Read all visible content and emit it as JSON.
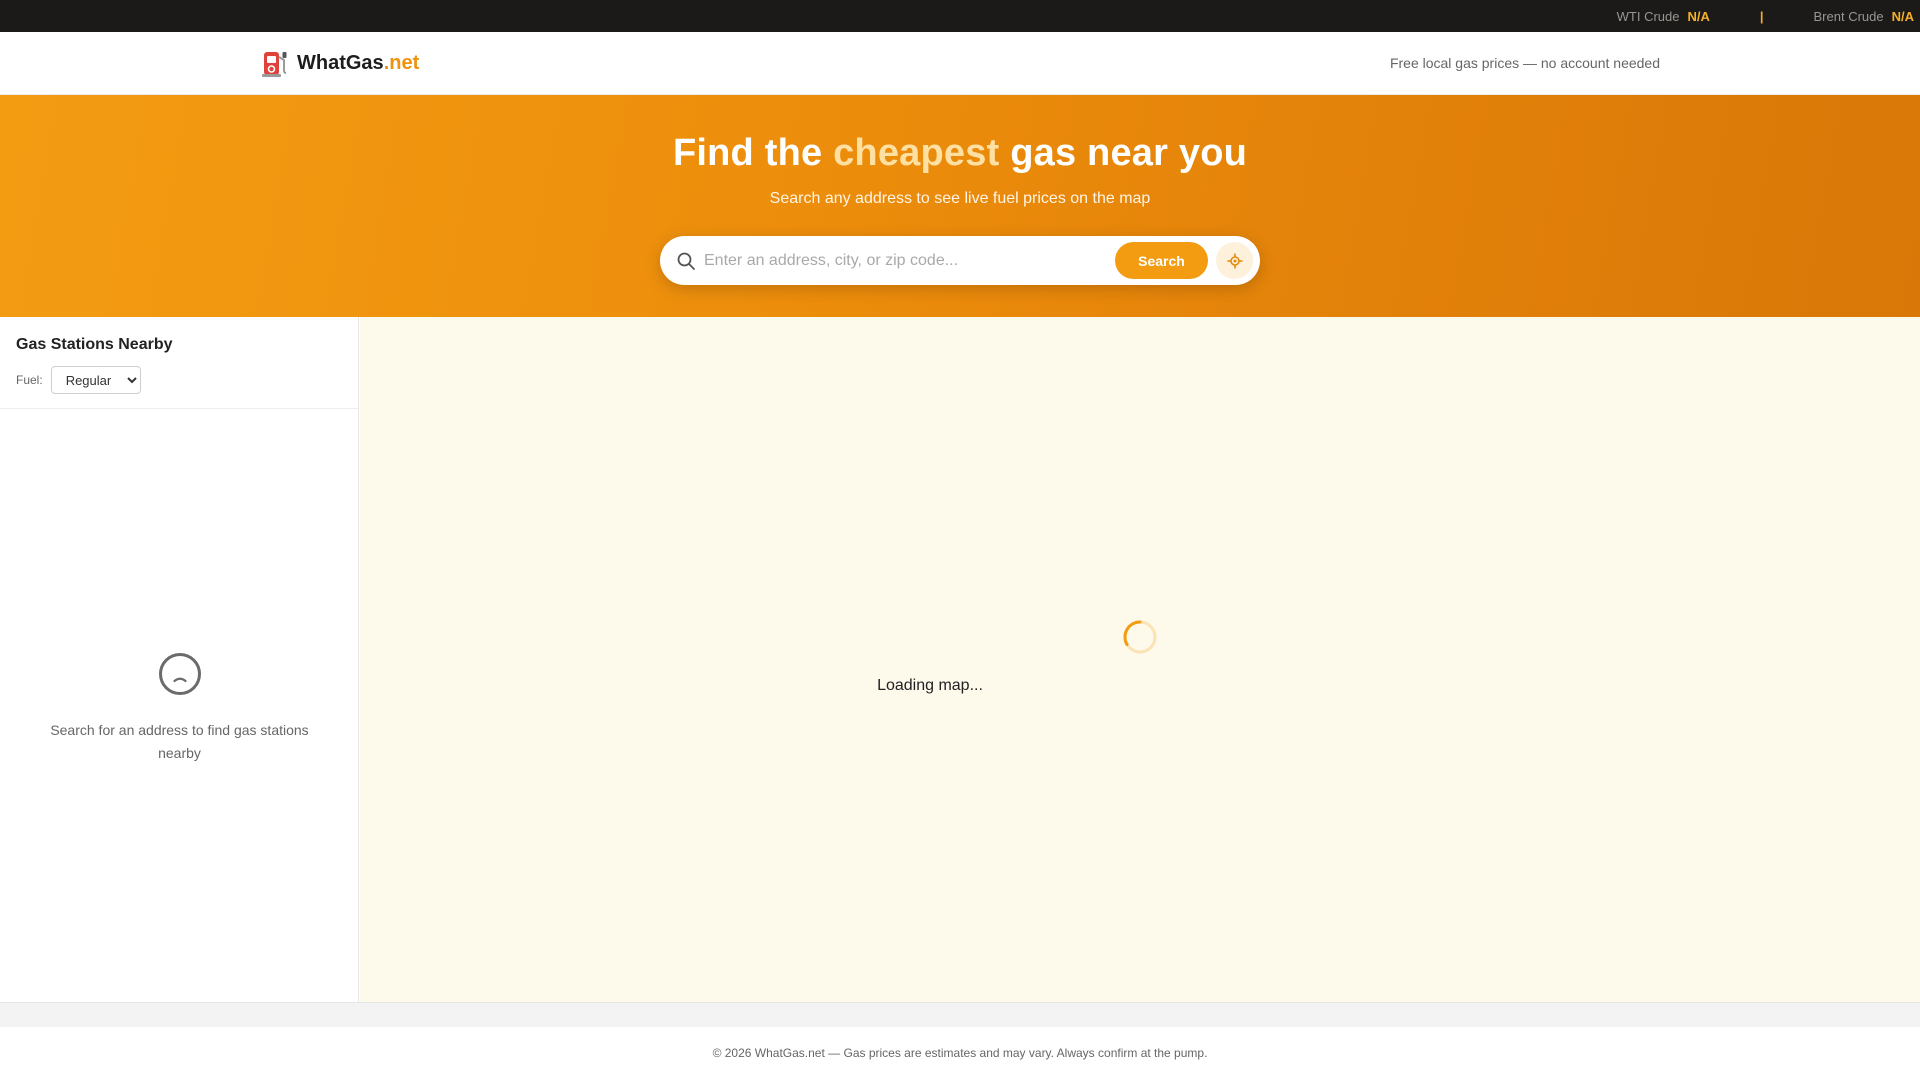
{
  "ticker": {
    "wti_label": "WTI Crude",
    "wti_value": "N/A",
    "separator": "|",
    "brent_label": "Brent Crude",
    "brent_value": "N/A"
  },
  "header": {
    "logo_icon": "fuel-pump-icon",
    "brand_main": "WhatGas",
    "brand_accent": ".net",
    "tagline": "Free local gas prices — no account needed"
  },
  "hero": {
    "title_part1": "Find the ",
    "title_highlight": "cheapest",
    "title_part2": " gas near you",
    "subtitle": "Search any address to see live fuel prices on the map",
    "search_placeholder": "Enter an address, city, or zip code...",
    "search_value": "",
    "search_button": "Search",
    "locate_icon": "crosshair-locate-icon"
  },
  "sidebar": {
    "title": "Gas Stations Nearby",
    "fuel_label": "Fuel:",
    "fuel_selected": "Regular",
    "empty_message": "Search for an address to find gas stations nearby"
  },
  "map": {
    "loading_text": "Loading map..."
  },
  "footer": {
    "text": "© 2026 WhatGas.net — Gas prices are estimates and may vary. Always confirm at the pump."
  },
  "colors": {
    "accent": "#f39c12",
    "ticker_bg": "#1c1a18",
    "map_bg": "#fdf9eb"
  }
}
